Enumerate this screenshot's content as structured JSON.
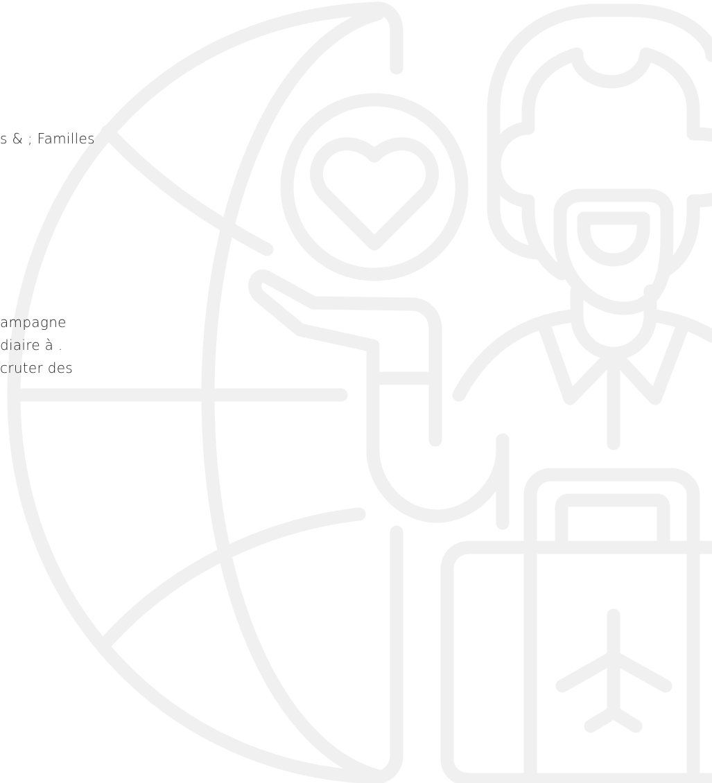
{
  "colors": {
    "illustration_stroke": "#f0f0f0",
    "text": "#1f1f1f",
    "background": "#ffffff"
  },
  "icons": [
    "globe-icon",
    "heart-in-circle-icon",
    "person-icon",
    "hand-icon",
    "suitcase-icon",
    "airplane-icon"
  ],
  "text": {
    "line_1": "s & ; Familles",
    "line_2": "ampagne",
    "line_3": "diaire à .",
    "line_4": "cruter des"
  }
}
